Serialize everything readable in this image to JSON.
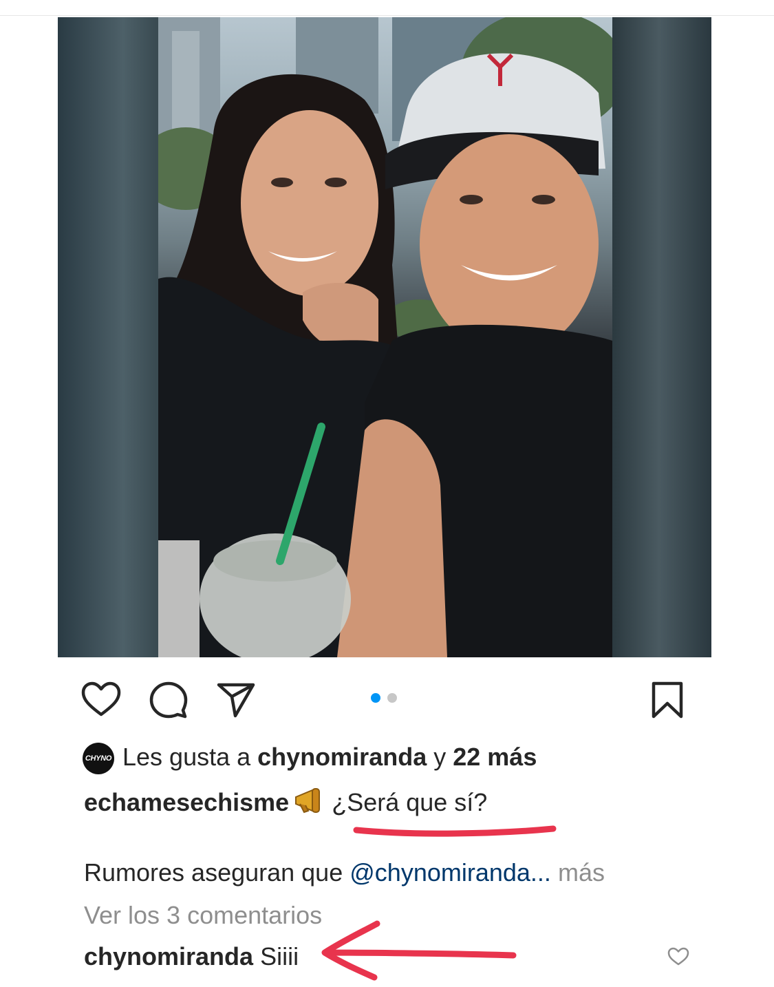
{
  "post": {
    "likes": {
      "avatar_text": "CHYNO",
      "prefix": "Les gusta a",
      "user": "chynomiranda",
      "conj": "y",
      "others": "22 más"
    },
    "caption": {
      "username": "echamesechisme",
      "emoji": "megaphone",
      "text": "¿Será que sí?"
    },
    "description": {
      "text": "Rumores aseguran que",
      "mention": "@chynomiranda...",
      "more": "más"
    },
    "view_comments": "Ver los 3 comentarios",
    "comment": {
      "username": "chynomiranda",
      "text": "Siiii"
    },
    "carousel": {
      "total": 2,
      "active": 1
    }
  },
  "icons": {
    "like": "heart-icon",
    "comment": "comment-bubble-icon",
    "share": "paper-plane-icon",
    "save": "bookmark-icon",
    "comment_like": "small-heart-icon"
  },
  "colors": {
    "active_dot": "#0095f6",
    "inactive_dot": "#c7c7c7",
    "annotation": "#e8344d",
    "mention": "#00376b",
    "muted": "#8e8e8e"
  }
}
